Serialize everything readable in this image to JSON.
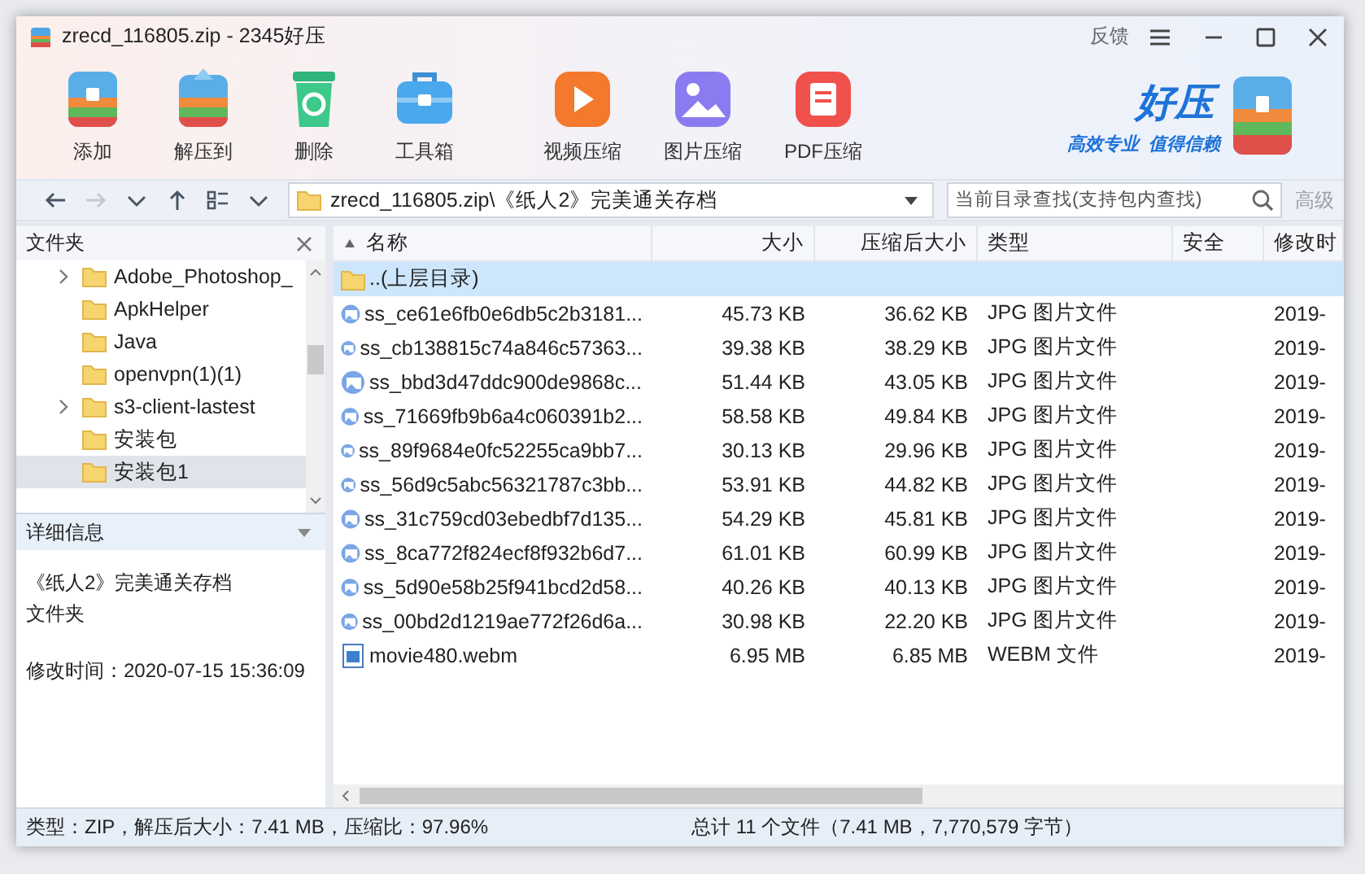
{
  "window": {
    "title": "zrecd_116805.zip - 2345好压",
    "feedback": "反馈"
  },
  "toolbar": {
    "groups": [
      [
        {
          "kind": "add",
          "label": "添加"
        },
        {
          "kind": "extract",
          "label": "解压到"
        },
        {
          "kind": "delete",
          "label": "删除"
        },
        {
          "kind": "toolbox",
          "label": "工具箱"
        }
      ],
      [
        {
          "kind": "video",
          "label": "视频压缩"
        },
        {
          "kind": "image",
          "label": "图片压缩"
        },
        {
          "kind": "pdf",
          "label": "PDF压缩"
        }
      ]
    ],
    "logo": {
      "name": "好压",
      "tagline": "高效专业  值得信赖"
    }
  },
  "address_bar": {
    "nav": [
      {
        "kind": "back",
        "disabled": false
      },
      {
        "kind": "forward",
        "disabled": true
      },
      {
        "kind": "history",
        "disabled": false
      },
      {
        "kind": "up",
        "disabled": false
      },
      {
        "kind": "view",
        "disabled": false
      },
      {
        "kind": "view_menu",
        "disabled": false
      }
    ],
    "path": "zrecd_116805.zip\\《纸人2》完美通关存档",
    "search_placeholder": "当前目录查找(支持包内查找)",
    "advanced": {
      "label": "高级",
      "disabled": true
    }
  },
  "sidebar": {
    "title": "文件夹",
    "items": [
      {
        "label": "Adobe_Photoshop_",
        "expandable": true,
        "selected": false
      },
      {
        "label": "ApkHelper",
        "expandable": false,
        "selected": false
      },
      {
        "label": "Java",
        "expandable": false,
        "selected": false
      },
      {
        "label": "openvpn(1)(1)",
        "expandable": false,
        "selected": false
      },
      {
        "label": "s3-client-lastest",
        "expandable": true,
        "selected": false
      },
      {
        "label": "安装包",
        "expandable": false,
        "selected": false
      },
      {
        "label": "安装包1",
        "expandable": false,
        "selected": true
      }
    ],
    "details": {
      "title": "详细信息",
      "name": "《纸人2》完美通关存档",
      "type": "文件夹",
      "modified": "修改时间：2020-07-15 15:36:09"
    }
  },
  "table": {
    "columns": [
      "名称",
      "大小",
      "压缩后大小",
      "类型",
      "安全",
      "修改时"
    ],
    "rows": [
      {
        "kind": "folder",
        "name": "..(上层目录)",
        "selected": true
      },
      {
        "kind": "image",
        "name": "ss_ce61e6fb0e6db5c2b3181...",
        "size": "45.73 KB",
        "packed": "36.62 KB",
        "type": "JPG 图片文件",
        "modified": "2019-",
        "selected": false
      },
      {
        "kind": "image",
        "name": "ss_cb138815c74a846c57363...",
        "size": "39.38 KB",
        "packed": "38.29 KB",
        "type": "JPG 图片文件",
        "modified": "2019-",
        "selected": false
      },
      {
        "kind": "image",
        "name": "ss_bbd3d47ddc900de9868c...",
        "size": "51.44 KB",
        "packed": "43.05 KB",
        "type": "JPG 图片文件",
        "modified": "2019-",
        "selected": false
      },
      {
        "kind": "image",
        "name": "ss_71669fb9b6a4c060391b2...",
        "size": "58.58 KB",
        "packed": "49.84 KB",
        "type": "JPG 图片文件",
        "modified": "2019-",
        "selected": false
      },
      {
        "kind": "image",
        "name": "ss_89f9684e0fc52255ca9bb7...",
        "size": "30.13 KB",
        "packed": "29.96 KB",
        "type": "JPG 图片文件",
        "modified": "2019-",
        "selected": false
      },
      {
        "kind": "image",
        "name": "ss_56d9c5abc56321787c3bb...",
        "size": "53.91 KB",
        "packed": "44.82 KB",
        "type": "JPG 图片文件",
        "modified": "2019-",
        "selected": false
      },
      {
        "kind": "image",
        "name": "ss_31c759cd03ebedbf7d135...",
        "size": "54.29 KB",
        "packed": "45.81 KB",
        "type": "JPG 图片文件",
        "modified": "2019-",
        "selected": false
      },
      {
        "kind": "image",
        "name": "ss_8ca772f824ecf8f932b6d7...",
        "size": "61.01 KB",
        "packed": "60.99 KB",
        "type": "JPG 图片文件",
        "modified": "2019-",
        "selected": false
      },
      {
        "kind": "image",
        "name": "ss_5d90e58b25f941bcd2d58...",
        "size": "40.26 KB",
        "packed": "40.13 KB",
        "type": "JPG 图片文件",
        "modified": "2019-",
        "selected": false
      },
      {
        "kind": "image",
        "name": "ss_00bd2d1219ae772f26d6a...",
        "size": "30.98 KB",
        "packed": "22.20 KB",
        "type": "JPG 图片文件",
        "modified": "2019-",
        "selected": false
      },
      {
        "kind": "video",
        "name": "movie480.webm",
        "size": "6.95 MB",
        "packed": "6.85 MB",
        "type": "WEBM 文件",
        "modified": "2019-",
        "selected": false
      }
    ]
  },
  "status_bar": {
    "left": "类型：ZIP，解压后大小：7.41 MB，压缩比：97.96%",
    "right": "总计 11 个文件（7.41 MB，7,770,579 字节）"
  }
}
